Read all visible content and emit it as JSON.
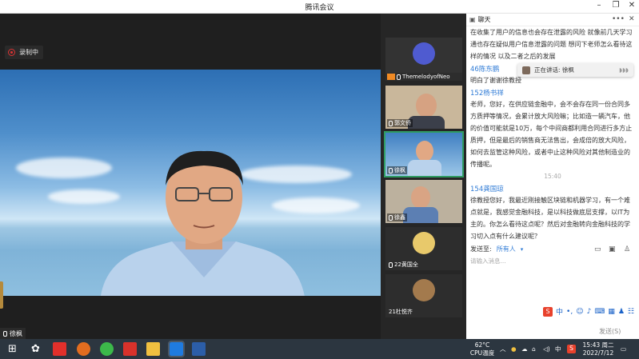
{
  "window": {
    "title": "腾讯会议"
  },
  "main": {
    "recording_label": "录制中",
    "speaker_name": "徐枫"
  },
  "participants": [
    {
      "name": "ThemelodyofNeo",
      "color": "#4f5bd0"
    },
    {
      "name": "郭文侨"
    },
    {
      "name": "徐枫"
    },
    {
      "name": "徐鑫"
    },
    {
      "name": "22黄国全"
    },
    {
      "name": "21杜悦齐"
    }
  ],
  "chat": {
    "title": "聊天",
    "messages": [
      {
        "lines": [
          "在收集了用户的信息也会存在泄露的风险 就像前几天学习",
          "通也存在疑似用户信息泄露的问题 想问下老师怎么看待这",
          "样的情况 以及二者之后的发展"
        ]
      },
      {
        "sender": "46陈东鹏",
        "lines": [
          "明白了谢谢徐教授"
        ]
      },
      {
        "sender": "152杨书祥",
        "lines": [
          "老师，您好，在供应链金融中，会不会存在同一份合同多",
          "方质押等情况，会累计放大风险嘛；比如造一辆汽车，他",
          "的价值可能就是10万，每个中间商都利用合同进行多方止",
          "质押，但是最后的销售商无法售出，会成倍的放大风险，",
          "如何去监管这种风险，或者中止这种风险对其他制造业的",
          "传播呢。"
        ]
      },
      {
        "timestamp": "15:40"
      },
      {
        "sender": "154龚国琼",
        "lines": [
          "徐教授您好，我最近刚接触区块链和机器学习，有一个难",
          "点就是，我感觉金融科技，是以科技做底层支撑，以IT为",
          "主的。你怎么看待这点呢？然后对金融转向金融科技的学",
          "习切入点有什么建议呢？"
        ]
      }
    ],
    "speaking_label": "正在讲话: 徐枫",
    "send_to_label": "发送至:",
    "send_to_value": "所有人",
    "input_placeholder": "请输入消息...",
    "send_button": "发送(S)"
  },
  "taskbar": {
    "temperature": "62°C",
    "temp_label": "CPU温度",
    "time": "15:43 周二",
    "date": "2022/7/12",
    "ime": "中"
  }
}
